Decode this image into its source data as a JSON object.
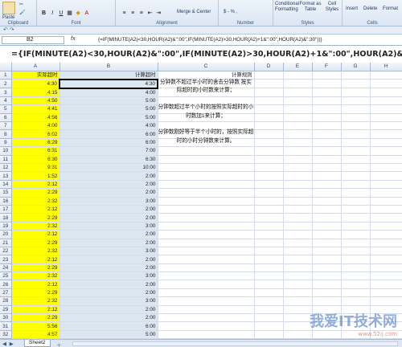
{
  "ribbon": {
    "paste_label": "Paste",
    "font_group_label": "Font",
    "alignment_group_label": "Alignment",
    "merge_center_label": "Merge & Center",
    "number_group_label": "Number",
    "number_format": "$ - % ,",
    "conditional_label": "Conditional Formatting",
    "format_table_label": "Format as Table",
    "cell_styles_label": "Cell Styles",
    "styles_group_label": "Styles",
    "insert_label": "Insert",
    "delete_label": "Delete",
    "format_label": "Format",
    "cells_group_label": "Cells",
    "clipboard_label": "Clipboard"
  },
  "formula_bar": {
    "name_box": "B2",
    "fx": "fx",
    "formula": "{=IF(MINUTE(A2)<30,HOUR(A2)&\":00\",IF(MINUTE(A2)>30,HOUR(A2)+1&\":00\",HOUR(A2)&\":30\"))}"
  },
  "big_formula": "={IF(MINUTE(A2)<30,HOUR(A2)&\":00\",IF(MINUTE(A2)>30,HOUR(A2)+1&\":00\",HOUR(A2)&\":30\"))}",
  "columns": [
    "A",
    "B",
    "C",
    "D",
    "E",
    "F",
    "G",
    "H",
    "I"
  ],
  "headers": {
    "A1": "实际超时",
    "B1": "计算超时",
    "C1": "计算规则"
  },
  "rows": [
    {
      "n": 2,
      "a": "4:30",
      "b": "4:30"
    },
    {
      "n": 3,
      "a": "4:15",
      "b": "4:00"
    },
    {
      "n": 4,
      "a": "4:50",
      "b": "5:00"
    },
    {
      "n": 5,
      "a": "4:41",
      "b": "5:00"
    },
    {
      "n": 6,
      "a": "4:56",
      "b": "5:00"
    },
    {
      "n": 7,
      "a": "4:00",
      "b": "4:00"
    },
    {
      "n": 8,
      "a": "6:02",
      "b": "6:00"
    },
    {
      "n": 9,
      "a": "6:29",
      "b": "6:00"
    },
    {
      "n": 10,
      "a": "6:31",
      "b": "7:00"
    },
    {
      "n": 11,
      "a": "6:30",
      "b": "6:30"
    },
    {
      "n": 12,
      "a": "9:31",
      "b": "10:00"
    },
    {
      "n": 13,
      "a": "1:52",
      "b": "2:00"
    },
    {
      "n": 14,
      "a": "2:12",
      "b": "2:00"
    },
    {
      "n": 15,
      "a": "2:29",
      "b": "2:00"
    },
    {
      "n": 16,
      "a": "2:32",
      "b": "3:00"
    },
    {
      "n": 17,
      "a": "2:12",
      "b": "2:00"
    },
    {
      "n": 18,
      "a": "2:29",
      "b": "2:00"
    },
    {
      "n": 19,
      "a": "2:32",
      "b": "3:00"
    },
    {
      "n": 20,
      "a": "2:12",
      "b": "2:00"
    },
    {
      "n": 21,
      "a": "2:29",
      "b": "2:00"
    },
    {
      "n": 22,
      "a": "2:32",
      "b": "3:00"
    },
    {
      "n": 23,
      "a": "2:12",
      "b": "2:00"
    },
    {
      "n": 24,
      "a": "2:29",
      "b": "2:00"
    },
    {
      "n": 25,
      "a": "2:32",
      "b": "3:00"
    },
    {
      "n": 26,
      "a": "2:12",
      "b": "2:00"
    },
    {
      "n": 27,
      "a": "2:29",
      "b": "2:00"
    },
    {
      "n": 28,
      "a": "2:32",
      "b": "3:00"
    },
    {
      "n": 29,
      "a": "2:12",
      "b": "2:00"
    },
    {
      "n": 30,
      "a": "2:29",
      "b": "2:00"
    },
    {
      "n": 31,
      "a": "5:56",
      "b": "6:00"
    },
    {
      "n": 32,
      "a": "4:57",
      "b": "5:00"
    },
    {
      "n": 33,
      "a": "7:10",
      "b": "7:00"
    },
    {
      "n": 34,
      "a": "6:23",
      "b": "6:00"
    }
  ],
  "rules": [
    "分钟数不超过半小时的舍去分钟数 按实际超时的小时数来计算；",
    "分钟数超过半个小时的按照实际超时的小时数加1来计算；",
    "分钟数刚好等于半个小时的，按照实际超时的小时分钟数来计算。"
  ],
  "sheet_tab": "Sheet2",
  "watermark": {
    "text": "我爱IT技术网",
    "url": "www.52ij.com"
  },
  "colors": {
    "highlight_yellow": "#ffff00",
    "column_b_fill": "#dbe6f1"
  }
}
